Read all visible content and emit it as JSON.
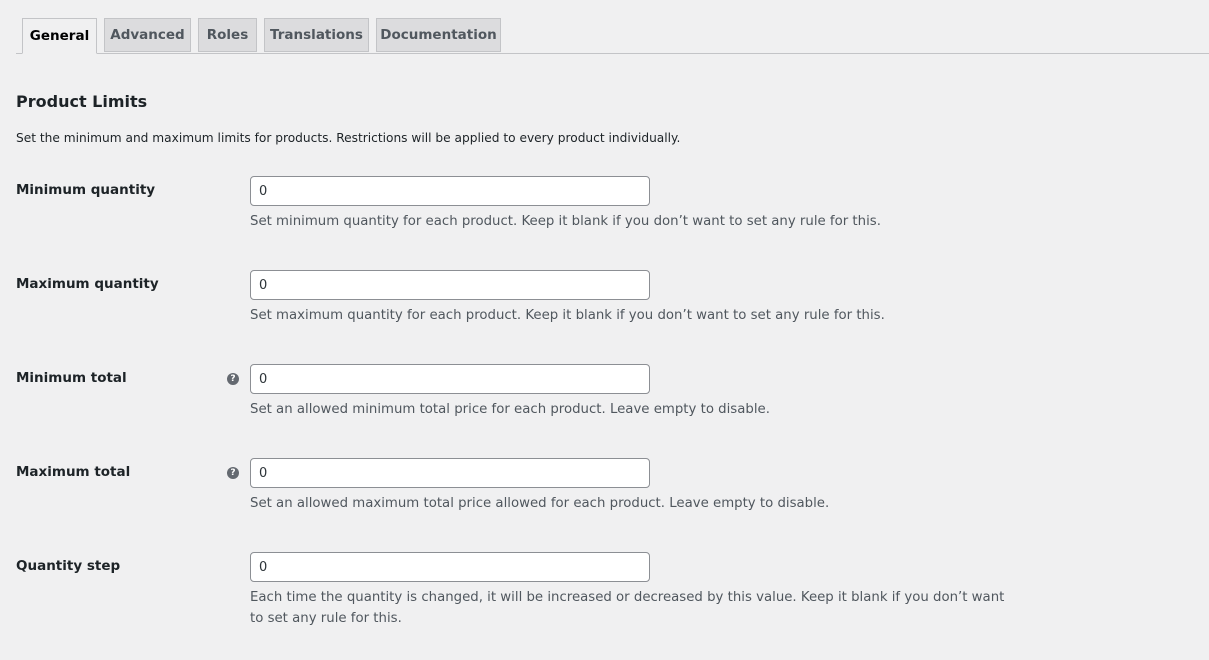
{
  "tabs": [
    {
      "label": "General",
      "active": true
    },
    {
      "label": "Advanced"
    },
    {
      "label": "Roles"
    },
    {
      "label": "Translations"
    },
    {
      "label": "Documentation"
    }
  ],
  "section": {
    "title": "Product Limits",
    "description": "Set the minimum and maximum limits for products. Restrictions will be applied to every product individually."
  },
  "fields": {
    "min_quantity": {
      "label": "Minimum quantity",
      "value": "0",
      "description": "Set minimum quantity for each product. Keep it blank if you don’t want to set any rule for this."
    },
    "max_quantity": {
      "label": "Maximum quantity",
      "value": "0",
      "description": "Set maximum quantity for each product. Keep it blank if you don’t want to set any rule for this."
    },
    "min_total": {
      "label": "Minimum total",
      "value": "0",
      "help_icon": "question-circle-icon",
      "description": "Set an allowed minimum total price for each product. Leave empty to disable."
    },
    "max_total": {
      "label": "Maximum total",
      "value": "0",
      "help_icon": "question-circle-icon",
      "description": "Set an allowed maximum total price allowed for each product. Leave empty to disable."
    },
    "quantity_step": {
      "label": "Quantity step",
      "value": "0",
      "description": "Each time the quantity is changed, it will be increased or decreased by this value. Keep it blank if you don’t want to set any rule for this."
    }
  },
  "colors": {
    "background": "#f0f0f1",
    "tab_inactive": "#dcdcde",
    "input_border": "#8c8f94",
    "description_text": "#50575e"
  }
}
